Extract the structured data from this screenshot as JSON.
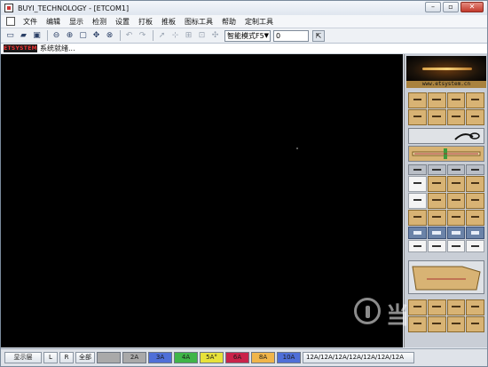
{
  "window": {
    "title": "BUYI_TECHNOLOGY - [ETCOM1]"
  },
  "window_controls": {
    "minimize": "–",
    "restore": "▫",
    "close": "✕"
  },
  "menu": [
    "文件",
    "编辑",
    "显示",
    "检测",
    "设置",
    "打板",
    "推板",
    "图标工具",
    "帮助",
    "定制工具"
  ],
  "toolbar": {
    "mode_select": "智能模式F5",
    "value_input": "0"
  },
  "status": {
    "brand": "ETSYSTEM",
    "text": "系统就绪..."
  },
  "panel": {
    "site_label": "www.etsystem.cn"
  },
  "layers": {
    "buttons": [
      "显示层",
      "L",
      "R",
      "全部"
    ],
    "swatches": [
      {
        "label": "",
        "color": "#a9a9a9"
      },
      {
        "label": "2A",
        "color": "#a9a9a9"
      },
      {
        "label": "3A",
        "color": "#4f6fd8"
      },
      {
        "label": "4A",
        "color": "#3fb548"
      },
      {
        "label": "5A°",
        "color": "#e7e23a"
      },
      {
        "label": "6A",
        "color": "#c9234a"
      },
      {
        "label": "8A",
        "color": "#f0b54a"
      },
      {
        "label": "10A",
        "color": "#4f6fd8"
      }
    ],
    "tail_label": "12A/12A/12A/12A/12A/12A/12A"
  },
  "watermark": {
    "text": "当"
  },
  "colors": {
    "canvas": "#000000",
    "panel_gold": "#d8b374"
  }
}
